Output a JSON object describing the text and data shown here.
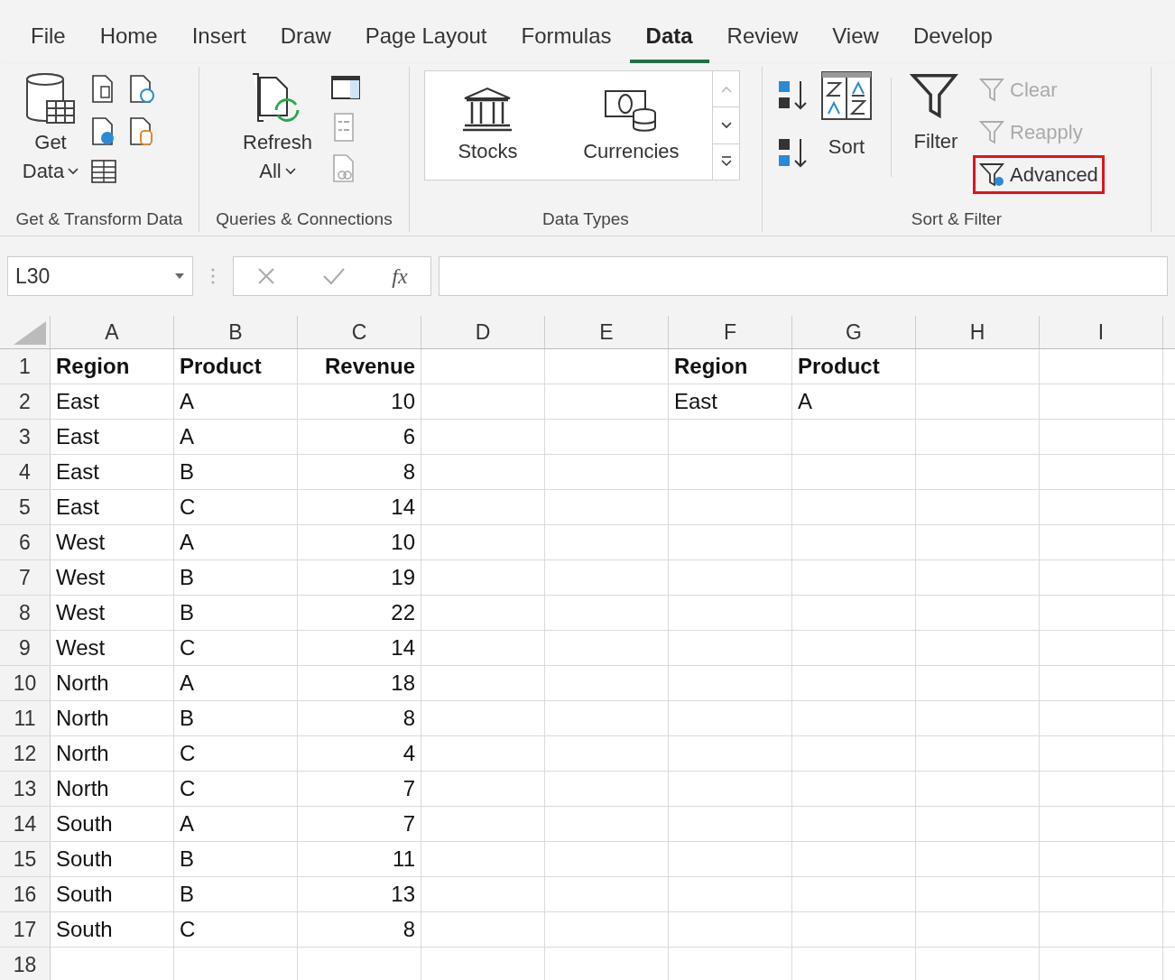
{
  "menu_tabs": [
    {
      "label": "File",
      "selected": false
    },
    {
      "label": "Home",
      "selected": false
    },
    {
      "label": "Insert",
      "selected": false
    },
    {
      "label": "Draw",
      "selected": false
    },
    {
      "label": "Page Layout",
      "selected": false
    },
    {
      "label": "Formulas",
      "selected": false
    },
    {
      "label": "Data",
      "selected": true
    },
    {
      "label": "Review",
      "selected": false
    },
    {
      "label": "View",
      "selected": false
    },
    {
      "label": "Develop",
      "selected": false
    }
  ],
  "ribbon": {
    "get_transform": {
      "get_data": [
        "Get",
        "Data"
      ],
      "label": "Get & Transform Data"
    },
    "queries": {
      "refresh_all": [
        "Refresh",
        "All"
      ],
      "label": "Queries & Connections"
    },
    "data_types": {
      "items": [
        "Stocks",
        "Currencies"
      ],
      "label": "Data Types"
    },
    "sort_filter": {
      "sort": "Sort",
      "filter": "Filter",
      "actions": [
        {
          "label": "Clear",
          "disabled": true,
          "highlighted": false
        },
        {
          "label": "Reapply",
          "disabled": true,
          "highlighted": false
        },
        {
          "label": "Advanced",
          "disabled": false,
          "highlighted": true
        }
      ],
      "label": "Sort & Filter"
    }
  },
  "formula_bar": {
    "name_box": "L30",
    "fx": "fx"
  },
  "sheet": {
    "columns": [
      {
        "label": "A",
        "kind": "text"
      },
      {
        "label": "B",
        "kind": "text"
      },
      {
        "label": "C",
        "kind": "number"
      },
      {
        "label": "D",
        "kind": "text"
      },
      {
        "label": "E",
        "kind": "text"
      },
      {
        "label": "F",
        "kind": "text"
      },
      {
        "label": "G",
        "kind": "text"
      },
      {
        "label": "H",
        "kind": "text"
      },
      {
        "label": "I",
        "kind": "text"
      }
    ],
    "rows": [
      {
        "number": "1",
        "bold": true,
        "cells": [
          "Region",
          "Product",
          "Revenue",
          null,
          null,
          "Region",
          "Product",
          null,
          null
        ]
      },
      {
        "number": "2",
        "bold": false,
        "cells": [
          "East",
          "A",
          "10",
          null,
          null,
          "East",
          "A",
          null,
          null
        ]
      },
      {
        "number": "3",
        "bold": false,
        "cells": [
          "East",
          "A",
          "6"
        ]
      },
      {
        "number": "4",
        "bold": false,
        "cells": [
          "East",
          "B",
          "8"
        ]
      },
      {
        "number": "5",
        "bold": false,
        "cells": [
          "East",
          "C",
          "14"
        ]
      },
      {
        "number": "6",
        "bold": false,
        "cells": [
          "West",
          "A",
          "10"
        ]
      },
      {
        "number": "7",
        "bold": false,
        "cells": [
          "West",
          "B",
          "19"
        ]
      },
      {
        "number": "8",
        "bold": false,
        "cells": [
          "West",
          "B",
          "22"
        ]
      },
      {
        "number": "9",
        "bold": false,
        "cells": [
          "West",
          "C",
          "14"
        ]
      },
      {
        "number": "10",
        "bold": false,
        "cells": [
          "North",
          "A",
          "18"
        ]
      },
      {
        "number": "11",
        "bold": false,
        "cells": [
          "North",
          "B",
          "8"
        ]
      },
      {
        "number": "12",
        "bold": false,
        "cells": [
          "North",
          "C",
          "4"
        ]
      },
      {
        "number": "13",
        "bold": false,
        "cells": [
          "North",
          "C",
          "7"
        ]
      },
      {
        "number": "14",
        "bold": false,
        "cells": [
          "South",
          "A",
          "7"
        ]
      },
      {
        "number": "15",
        "bold": false,
        "cells": [
          "South",
          "B",
          "11"
        ]
      },
      {
        "number": "16",
        "bold": false,
        "cells": [
          "South",
          "B",
          "13"
        ]
      },
      {
        "number": "17",
        "bold": false,
        "cells": [
          "South",
          "C",
          "8"
        ]
      },
      {
        "number": "18"
      }
    ]
  }
}
